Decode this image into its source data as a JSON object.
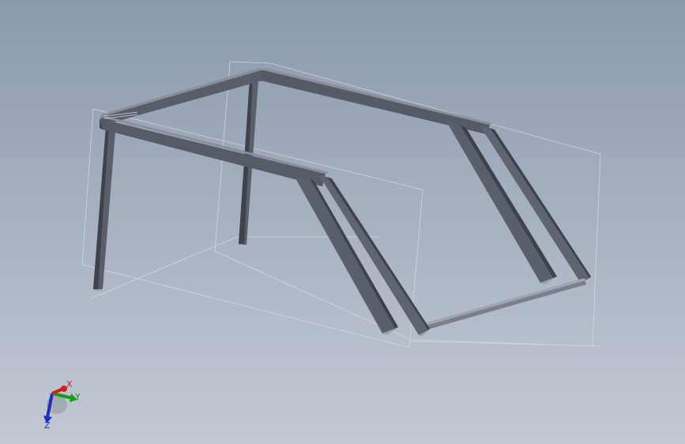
{
  "viewport": {
    "background_top": "#8c9aae",
    "background_bottom": "#c2c9d4",
    "member_color": "#5a5f6c",
    "member_shadow": "#3e424c",
    "member_light": "#8a8f9b",
    "plane_color": "#d8dce3"
  },
  "triad": {
    "x_label": "X",
    "y_label": "Y",
    "z_label": "Z",
    "x_color": "#d0201c",
    "y_color": "#1a9a1a",
    "z_color": "#1c2fb8"
  }
}
